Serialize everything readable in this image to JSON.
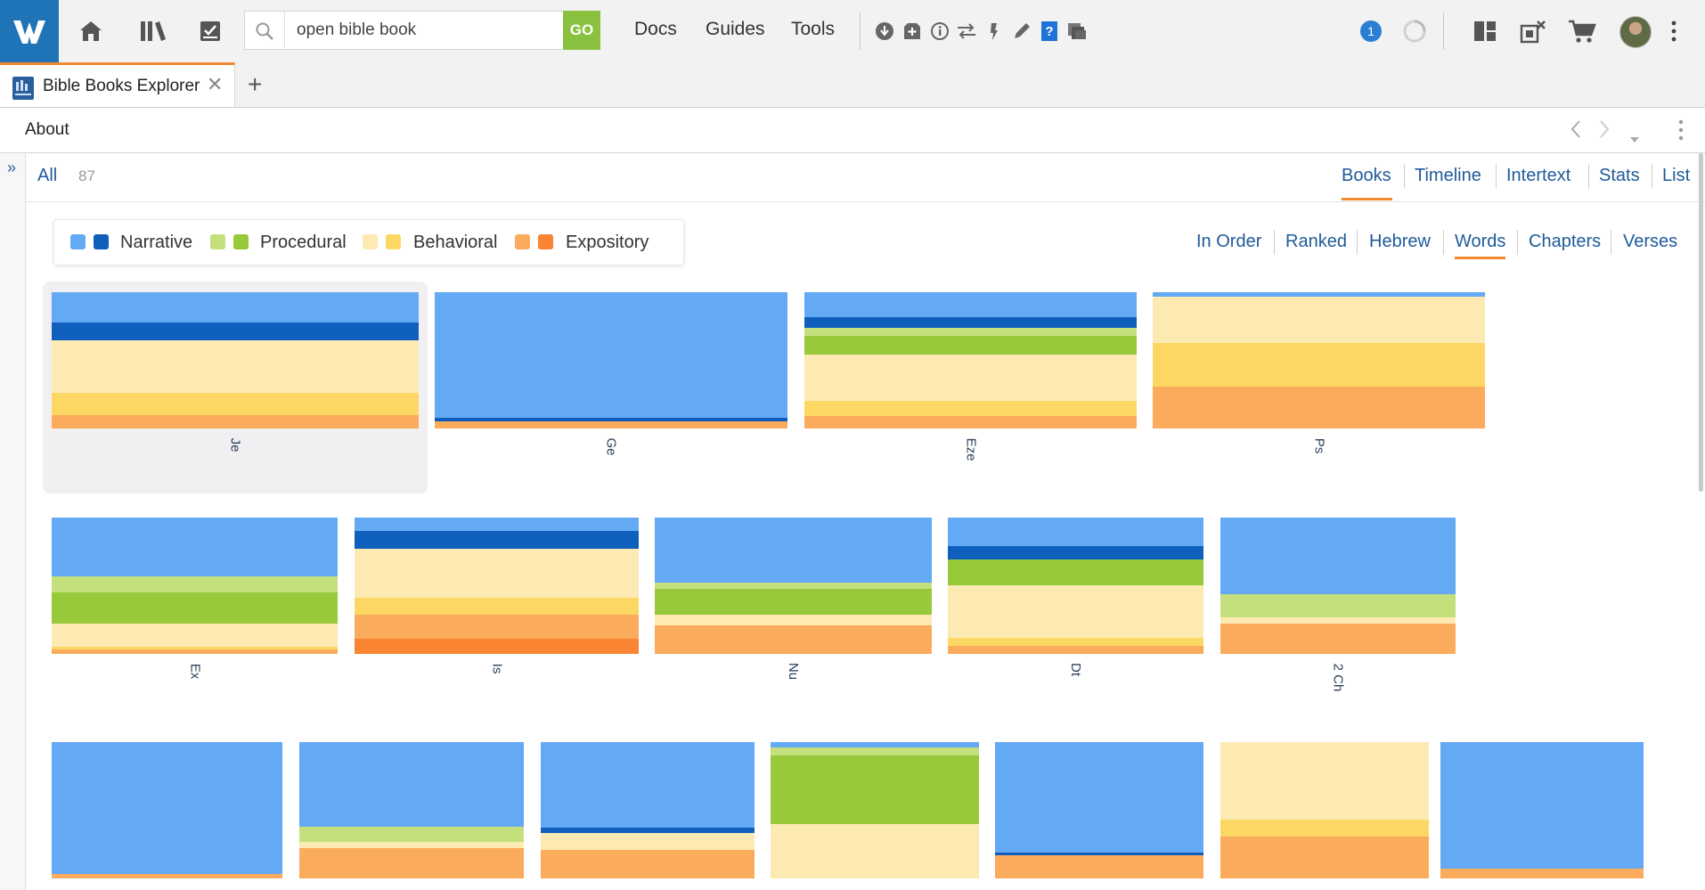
{
  "toolbar": {
    "search_value": "open bible book",
    "go_label": "GO",
    "nav": [
      "Docs",
      "Guides",
      "Tools"
    ],
    "notification_count": "1",
    "icons": [
      "home-icon",
      "library-icon",
      "checklist-icon",
      "download-icon",
      "add-icon",
      "info-icon",
      "sync-icon",
      "highlight-icon",
      "pen-icon",
      "help-icon",
      "copy-icon",
      "layout-icon",
      "close-panels-icon",
      "cart-icon",
      "avatar",
      "more-icon"
    ]
  },
  "tab": {
    "title": "Bible Books Explorer"
  },
  "about": {
    "label": "About"
  },
  "content_nav": {
    "all_label": "All",
    "all_count": "87",
    "views": [
      "Books",
      "Timeline",
      "Intertext",
      "Stats",
      "List"
    ],
    "active_view": "Books"
  },
  "legend": {
    "items": [
      {
        "label": "Narrative",
        "colors": [
          "#63a9f4",
          "#0f5fbd"
        ]
      },
      {
        "label": "Procedural",
        "colors": [
          "#c4e07d",
          "#97c93a"
        ]
      },
      {
        "label": "Behavioral",
        "colors": [
          "#fde9b2",
          "#fdd764"
        ]
      },
      {
        "label": "Expository",
        "colors": [
          "#fbab5c",
          "#f98432"
        ]
      }
    ]
  },
  "sort_tabs": [
    "In Order",
    "Ranked",
    "Hebrew",
    "Words",
    "Chapters",
    "Verses"
  ],
  "active_sort": "Words",
  "books": [
    {
      "name": "Je",
      "selected": true,
      "segments": [
        [
          "#63a9f4",
          0.22
        ],
        [
          "#0f5fbd",
          0.13
        ],
        [
          "#fde9b2",
          0.39
        ],
        [
          "#fdd764",
          0.16
        ],
        [
          "#fbab5c",
          0.1
        ]
      ]
    },
    {
      "name": "Ge",
      "segments": [
        [
          "#63a9f4",
          0.92
        ],
        [
          "#0f5fbd",
          0.03
        ],
        [
          "#fbab5c",
          0.05
        ]
      ]
    },
    {
      "name": "Eze",
      "segments": [
        [
          "#63a9f4",
          0.18
        ],
        [
          "#0f5fbd",
          0.08
        ],
        [
          "#c4e07d",
          0.06
        ],
        [
          "#97c93a",
          0.14
        ],
        [
          "#fde9b2",
          0.34
        ],
        [
          "#fdd764",
          0.11
        ],
        [
          "#fbab5c",
          0.09
        ]
      ]
    },
    {
      "name": "Ps",
      "segments": [
        [
          "#63a9f4",
          0.03
        ],
        [
          "#fde9b2",
          0.34
        ],
        [
          "#fdd764",
          0.32
        ],
        [
          "#fbab5c",
          0.31
        ]
      ]
    },
    {
      "name": "Ex",
      "segments": [
        [
          "#63a9f4",
          0.43
        ],
        [
          "#c4e07d",
          0.12
        ],
        [
          "#97c93a",
          0.23
        ],
        [
          "#fde9b2",
          0.17
        ],
        [
          "#fdd764",
          0.02
        ],
        [
          "#fbab5c",
          0.03
        ]
      ]
    },
    {
      "name": "Is",
      "segments": [
        [
          "#63a9f4",
          0.1
        ],
        [
          "#0f5fbd",
          0.13
        ],
        [
          "#fde9b2",
          0.36
        ],
        [
          "#fdd764",
          0.12
        ],
        [
          "#fbab5c",
          0.18
        ],
        [
          "#f98432",
          0.11
        ]
      ]
    },
    {
      "name": "Nu",
      "segments": [
        [
          "#63a9f4",
          0.48
        ],
        [
          "#c4e07d",
          0.04
        ],
        [
          "#97c93a",
          0.19
        ],
        [
          "#fde9b2",
          0.08
        ],
        [
          "#fbab5c",
          0.21
        ]
      ]
    },
    {
      "name": "Dt",
      "segments": [
        [
          "#63a9f4",
          0.21
        ],
        [
          "#0f5fbd",
          0.1
        ],
        [
          "#97c93a",
          0.19
        ],
        [
          "#fde9b2",
          0.38
        ],
        [
          "#fdd764",
          0.06
        ],
        [
          "#fbab5c",
          0.06
        ]
      ]
    },
    {
      "name": "2 Ch",
      "segments": [
        [
          "#63a9f4",
          0.56
        ],
        [
          "#c4e07d",
          0.17
        ],
        [
          "#fde9b2",
          0.05
        ],
        [
          "#fbab5c",
          0.22
        ]
      ]
    },
    {
      "name": "",
      "segments": [
        [
          "#63a9f4",
          0.97
        ],
        [
          "#fbab5c",
          0.03
        ]
      ]
    },
    {
      "name": "",
      "segments": [
        [
          "#63a9f4",
          0.62
        ],
        [
          "#c4e07d",
          0.11
        ],
        [
          "#fde9b2",
          0.05
        ],
        [
          "#fbab5c",
          0.22
        ]
      ]
    },
    {
      "name": "",
      "segments": [
        [
          "#63a9f4",
          0.63
        ],
        [
          "#0f5fbd",
          0.04
        ],
        [
          "#fde9b2",
          0.12
        ],
        [
          "#fbab5c",
          0.21
        ]
      ]
    },
    {
      "name": "",
      "segments": [
        [
          "#63a9f4",
          0.04
        ],
        [
          "#c4e07d",
          0.06
        ],
        [
          "#97c93a",
          0.5
        ],
        [
          "#fde9b2",
          0.4
        ]
      ]
    },
    {
      "name": "",
      "segments": [
        [
          "#63a9f4",
          0.81
        ],
        [
          "#0f5fbd",
          0.02
        ],
        [
          "#fbab5c",
          0.17
        ]
      ]
    },
    {
      "name": "",
      "segments": [
        [
          "#fde9b2",
          0.57
        ],
        [
          "#fdd764",
          0.12
        ],
        [
          "#fbab5c",
          0.31
        ]
      ]
    },
    {
      "name": "",
      "segments": [
        [
          "#63a9f4",
          0.93
        ],
        [
          "#fbab5c",
          0.07
        ]
      ]
    }
  ]
}
